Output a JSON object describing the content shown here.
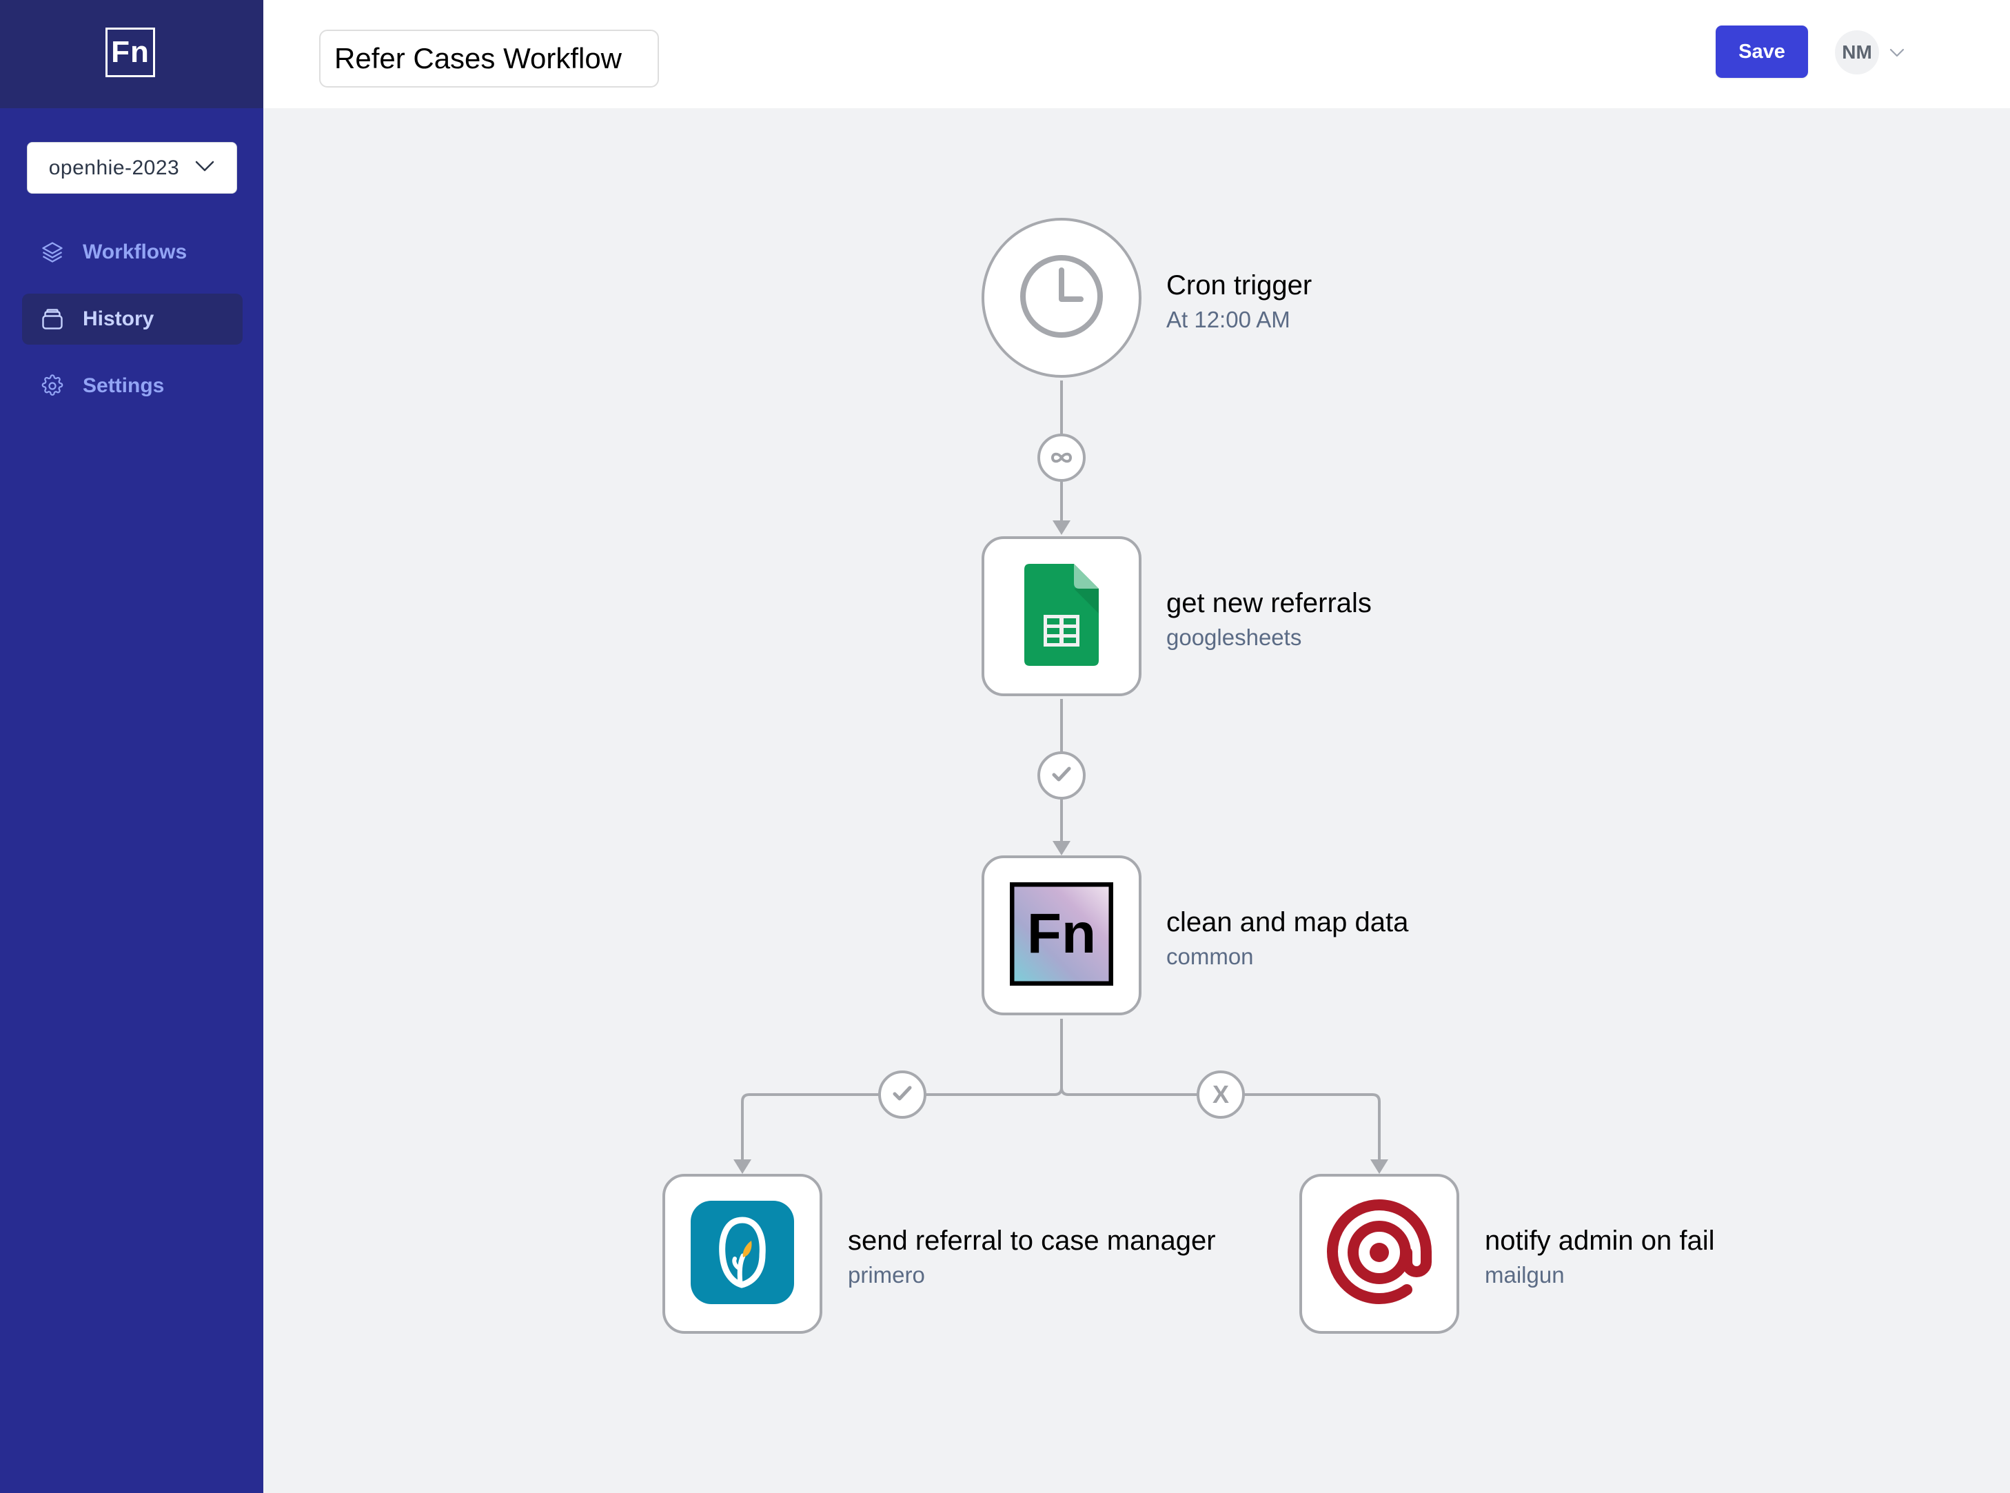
{
  "sidebar": {
    "logo_text": "Fn",
    "project": "openhie-2023",
    "items": [
      {
        "label": "Workflows",
        "icon": "layers-icon",
        "active": false
      },
      {
        "label": "History",
        "icon": "archive-icon",
        "active": true
      },
      {
        "label": "Settings",
        "icon": "gear-icon",
        "active": false
      }
    ]
  },
  "header": {
    "workflow_title": "Refer Cases Workflow",
    "save_label": "Save",
    "user_initials": "NM"
  },
  "workflow": {
    "trigger": {
      "name": "Cron trigger",
      "detail": "At 12:00 AM",
      "icon": "clock-icon"
    },
    "jobs": [
      {
        "id": "job1",
        "name": "get new referrals",
        "adaptor": "googlesheets",
        "icon": "googlesheets-icon"
      },
      {
        "id": "job2",
        "name": "clean and map data",
        "adaptor": "common",
        "icon": "fn-common-icon"
      },
      {
        "id": "job3",
        "name": "send referral to case manager",
        "adaptor": "primero",
        "icon": "primero-icon"
      },
      {
        "id": "job4",
        "name": "notify admin on fail",
        "adaptor": "mailgun",
        "icon": "mailgun-icon"
      }
    ],
    "edges": [
      {
        "from": "trigger",
        "to": "job1",
        "condition": "always",
        "badge": "infinity-icon"
      },
      {
        "from": "job1",
        "to": "job2",
        "condition": "on success",
        "badge": "check-icon"
      },
      {
        "from": "job2",
        "to": "job3",
        "condition": "on success",
        "badge": "check-icon"
      },
      {
        "from": "job2",
        "to": "job4",
        "condition": "on failure",
        "badge": "x-icon",
        "badge_text": "X"
      }
    ]
  },
  "colors": {
    "sidebar_bg": "#282c91",
    "sidebar_header_bg": "#262a6e",
    "primary_button": "#3a41d8",
    "canvas_bg": "#f1f2f4",
    "edge_gray": "#a7a9ae"
  }
}
